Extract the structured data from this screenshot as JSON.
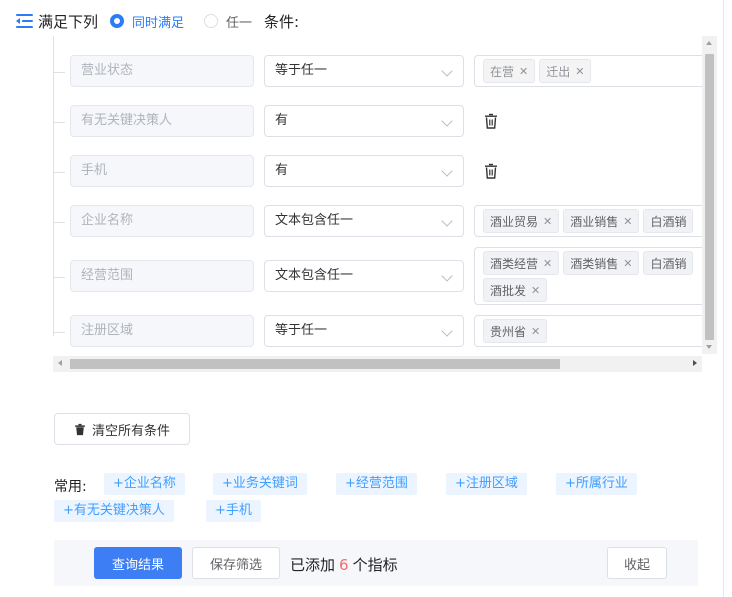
{
  "header": {
    "title": "满足下列",
    "radio_all": "同时满足",
    "radio_any": "任一",
    "suffix": "条件:",
    "selected": "all"
  },
  "conditions": [
    {
      "field": "营业状态",
      "operator": "等于任一",
      "values": [
        "在营",
        "迁出"
      ],
      "value_style": "lite"
    },
    {
      "field": "有无关键决策人",
      "operator": "有",
      "values": []
    },
    {
      "field": "手机",
      "operator": "有",
      "values": []
    },
    {
      "field": "企业名称",
      "operator": "文本包含任一",
      "values": [
        "酒业贸易",
        "酒业销售",
        "白酒销"
      ]
    },
    {
      "field": "经营范围",
      "operator": "文本包含任一",
      "values": [
        "酒类经营",
        "酒类销售",
        "白酒销",
        "酒批发"
      ]
    },
    {
      "field": "注册区域",
      "operator": "等于任一",
      "values": [
        "贵州省"
      ]
    }
  ],
  "clear_all_label": "清空所有条件",
  "common": {
    "label": "常用:",
    "items": [
      "+企业名称",
      "+业务关键词",
      "+经营范围",
      "+注册区域",
      "+所属行业",
      "+有无关键决策人",
      "+手机"
    ]
  },
  "footer": {
    "query_label": "查询结果",
    "save_label": "保存筛选",
    "added_prefix": "已添加",
    "added_count": "6",
    "added_suffix": "个指标",
    "collapse_label": "收起"
  },
  "colors": {
    "accent": "#2b7cf6",
    "count": "#f56c6c",
    "chip_bg": "#ecf5ff"
  }
}
